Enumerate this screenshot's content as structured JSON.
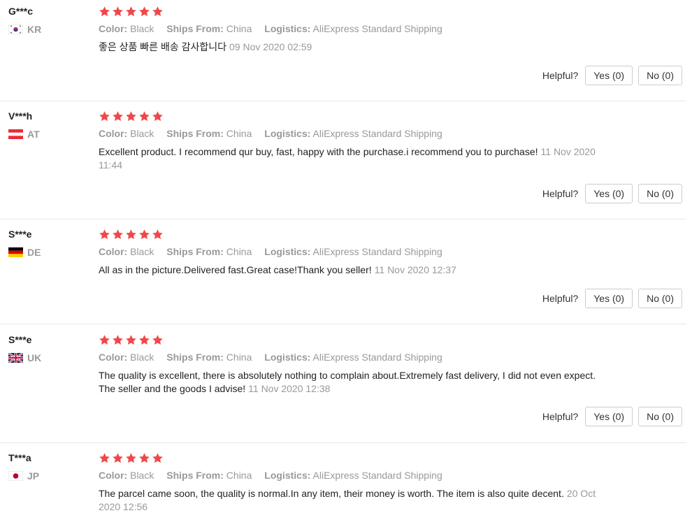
{
  "labels": {
    "color": "Color:",
    "ships_from": "Ships From:",
    "logistics": "Logistics:",
    "helpful": "Helpful?",
    "yes": "Yes (0)",
    "no": "No (0)"
  },
  "star_color": "#f0484a",
  "reviews": [
    {
      "user": "G***c",
      "country": "KR",
      "flag": "flag-south-korea-icon",
      "rating": 5,
      "color": "Black",
      "ships_from": "China",
      "logistics": "AliExpress Standard Shipping",
      "text": "좋은 상품 빠른 배송 감사합니다",
      "date": "09 Nov 2020 02:59"
    },
    {
      "user": "V***h",
      "country": "AT",
      "flag": "flag-austria-icon",
      "rating": 5,
      "color": "Black",
      "ships_from": "China",
      "logistics": "AliExpress Standard Shipping",
      "text": "Excellent product. I recommend qur buy, fast, happy with the purchase.i recommend you to purchase!",
      "date": "11 Nov 2020 11:44"
    },
    {
      "user": "S***e",
      "country": "DE",
      "flag": "flag-germany-icon",
      "rating": 5,
      "color": "Black",
      "ships_from": "China",
      "logistics": "AliExpress Standard Shipping",
      "text": "All as in the picture.Delivered fast.Great case!Thank you seller!",
      "date": "11 Nov 2020 12:37"
    },
    {
      "user": "S***e",
      "country": "UK",
      "flag": "flag-uk-icon",
      "rating": 5,
      "color": "Black",
      "ships_from": "China",
      "logistics": "AliExpress Standard Shipping",
      "text": "The quality is excellent, there is absolutely nothing to complain about.Extremely fast delivery, I did not even expect. The seller and the goods I advise!",
      "date": "11 Nov 2020 12:38"
    },
    {
      "user": "T***a",
      "country": "JP",
      "flag": "flag-japan-icon",
      "rating": 5,
      "color": "Black",
      "ships_from": "China",
      "logistics": "AliExpress Standard Shipping",
      "text": "The parcel came soon, the quality is normal.In any item, their money is worth. The item is also quite decent.",
      "date": "20 Oct 2020 12:56"
    }
  ]
}
